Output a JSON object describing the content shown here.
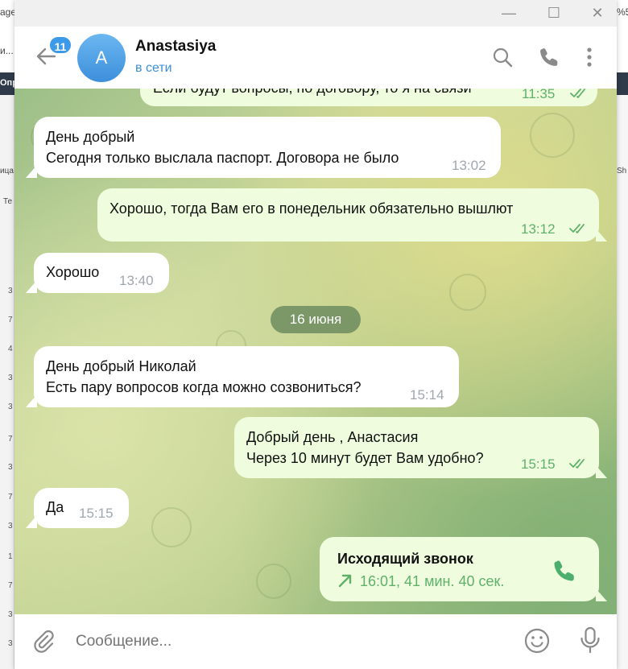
{
  "background_app": {
    "fragments": [
      "age",
      "%5",
      "и...",
      "Опр",
      "ица",
      "Sh",
      "Те"
    ],
    "row_numbers": [
      "3",
      "7",
      "4",
      "3",
      "3",
      "7",
      "3",
      "7",
      "3",
      "1",
      "7",
      "3",
      "3",
      "3"
    ]
  },
  "window": {
    "controls": {
      "minimize": "—",
      "maximize": "☐",
      "close": "✕"
    }
  },
  "header": {
    "unread_badge": "11",
    "avatar_letter": "A",
    "contact_name": "Anastasiya",
    "status": "в сети",
    "icons": [
      "back-arrow-icon",
      "search-icon",
      "phone-icon",
      "more-icon"
    ]
  },
  "messages": [
    {
      "id": "m0",
      "dir": "out",
      "lines": [
        "Если будут вопросы, по договору, то я на связи"
      ],
      "time": "11:35",
      "read": true
    },
    {
      "id": "m1",
      "dir": "in",
      "lines": [
        "День добрый",
        "Сегодня только выслала паспорт. Договора не было"
      ],
      "time": "13:02"
    },
    {
      "id": "m2",
      "dir": "out",
      "lines": [
        "Хорошо, тогда Вам его в понедельник обязательно вышлют"
      ],
      "time": "13:12",
      "read": true
    },
    {
      "id": "m3",
      "dir": "in",
      "lines": [
        "Хорошо"
      ],
      "time": "13:40"
    },
    {
      "id": "m4",
      "dir": "in",
      "lines": [
        "День добрый Николай",
        "Есть пару вопросов когда можно созвониться?"
      ],
      "time": "15:14"
    },
    {
      "id": "m5",
      "dir": "out",
      "lines": [
        "Добрый день , Анастасия",
        "Через 10 минут будет Вам удобно?"
      ],
      "time": "15:15",
      "read": true
    },
    {
      "id": "m6",
      "dir": "in",
      "lines": [
        "Да"
      ],
      "time": "15:15"
    }
  ],
  "date_separator": "16 июня",
  "call": {
    "title": "Исходящий звонок",
    "meta": "16:01, 41 мин. 40 сек.",
    "icons": [
      "outgoing-arrow-icon",
      "phone-icon"
    ]
  },
  "composer": {
    "placeholder": "Сообщение...",
    "icons": [
      "attach-icon",
      "emoji-icon",
      "microphone-icon"
    ]
  },
  "colors": {
    "accent": "#3d9ae8",
    "incoming_bubble": "#ffffff",
    "outgoing_bubble": "#effdde",
    "outgoing_meta": "#5fb16a",
    "date_pill": "#6b8f5e"
  }
}
